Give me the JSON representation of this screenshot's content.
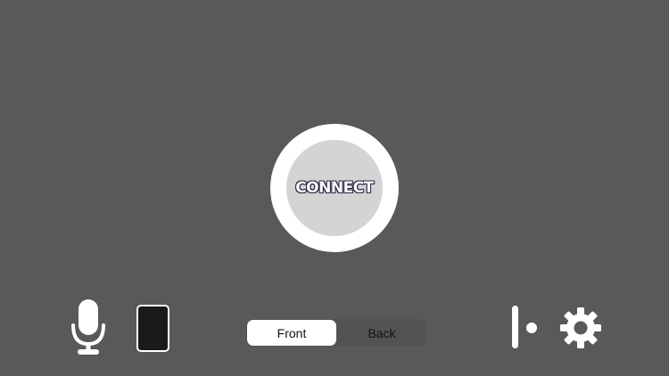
{
  "connect": {
    "label": "CONNECT"
  },
  "controls": {
    "microphone_icon": "microphone-icon",
    "phone_icon": "phone-icon",
    "switch_icon": "toggle-slider-icon",
    "settings_icon": "gear-icon"
  },
  "camera": {
    "options": [
      "Front",
      "Back"
    ],
    "selected": "Front"
  },
  "colors": {
    "background": "#595959",
    "button_outer": "#ffffff",
    "button_inner": "#d4d4d4",
    "label_outline": "#2a2440"
  }
}
